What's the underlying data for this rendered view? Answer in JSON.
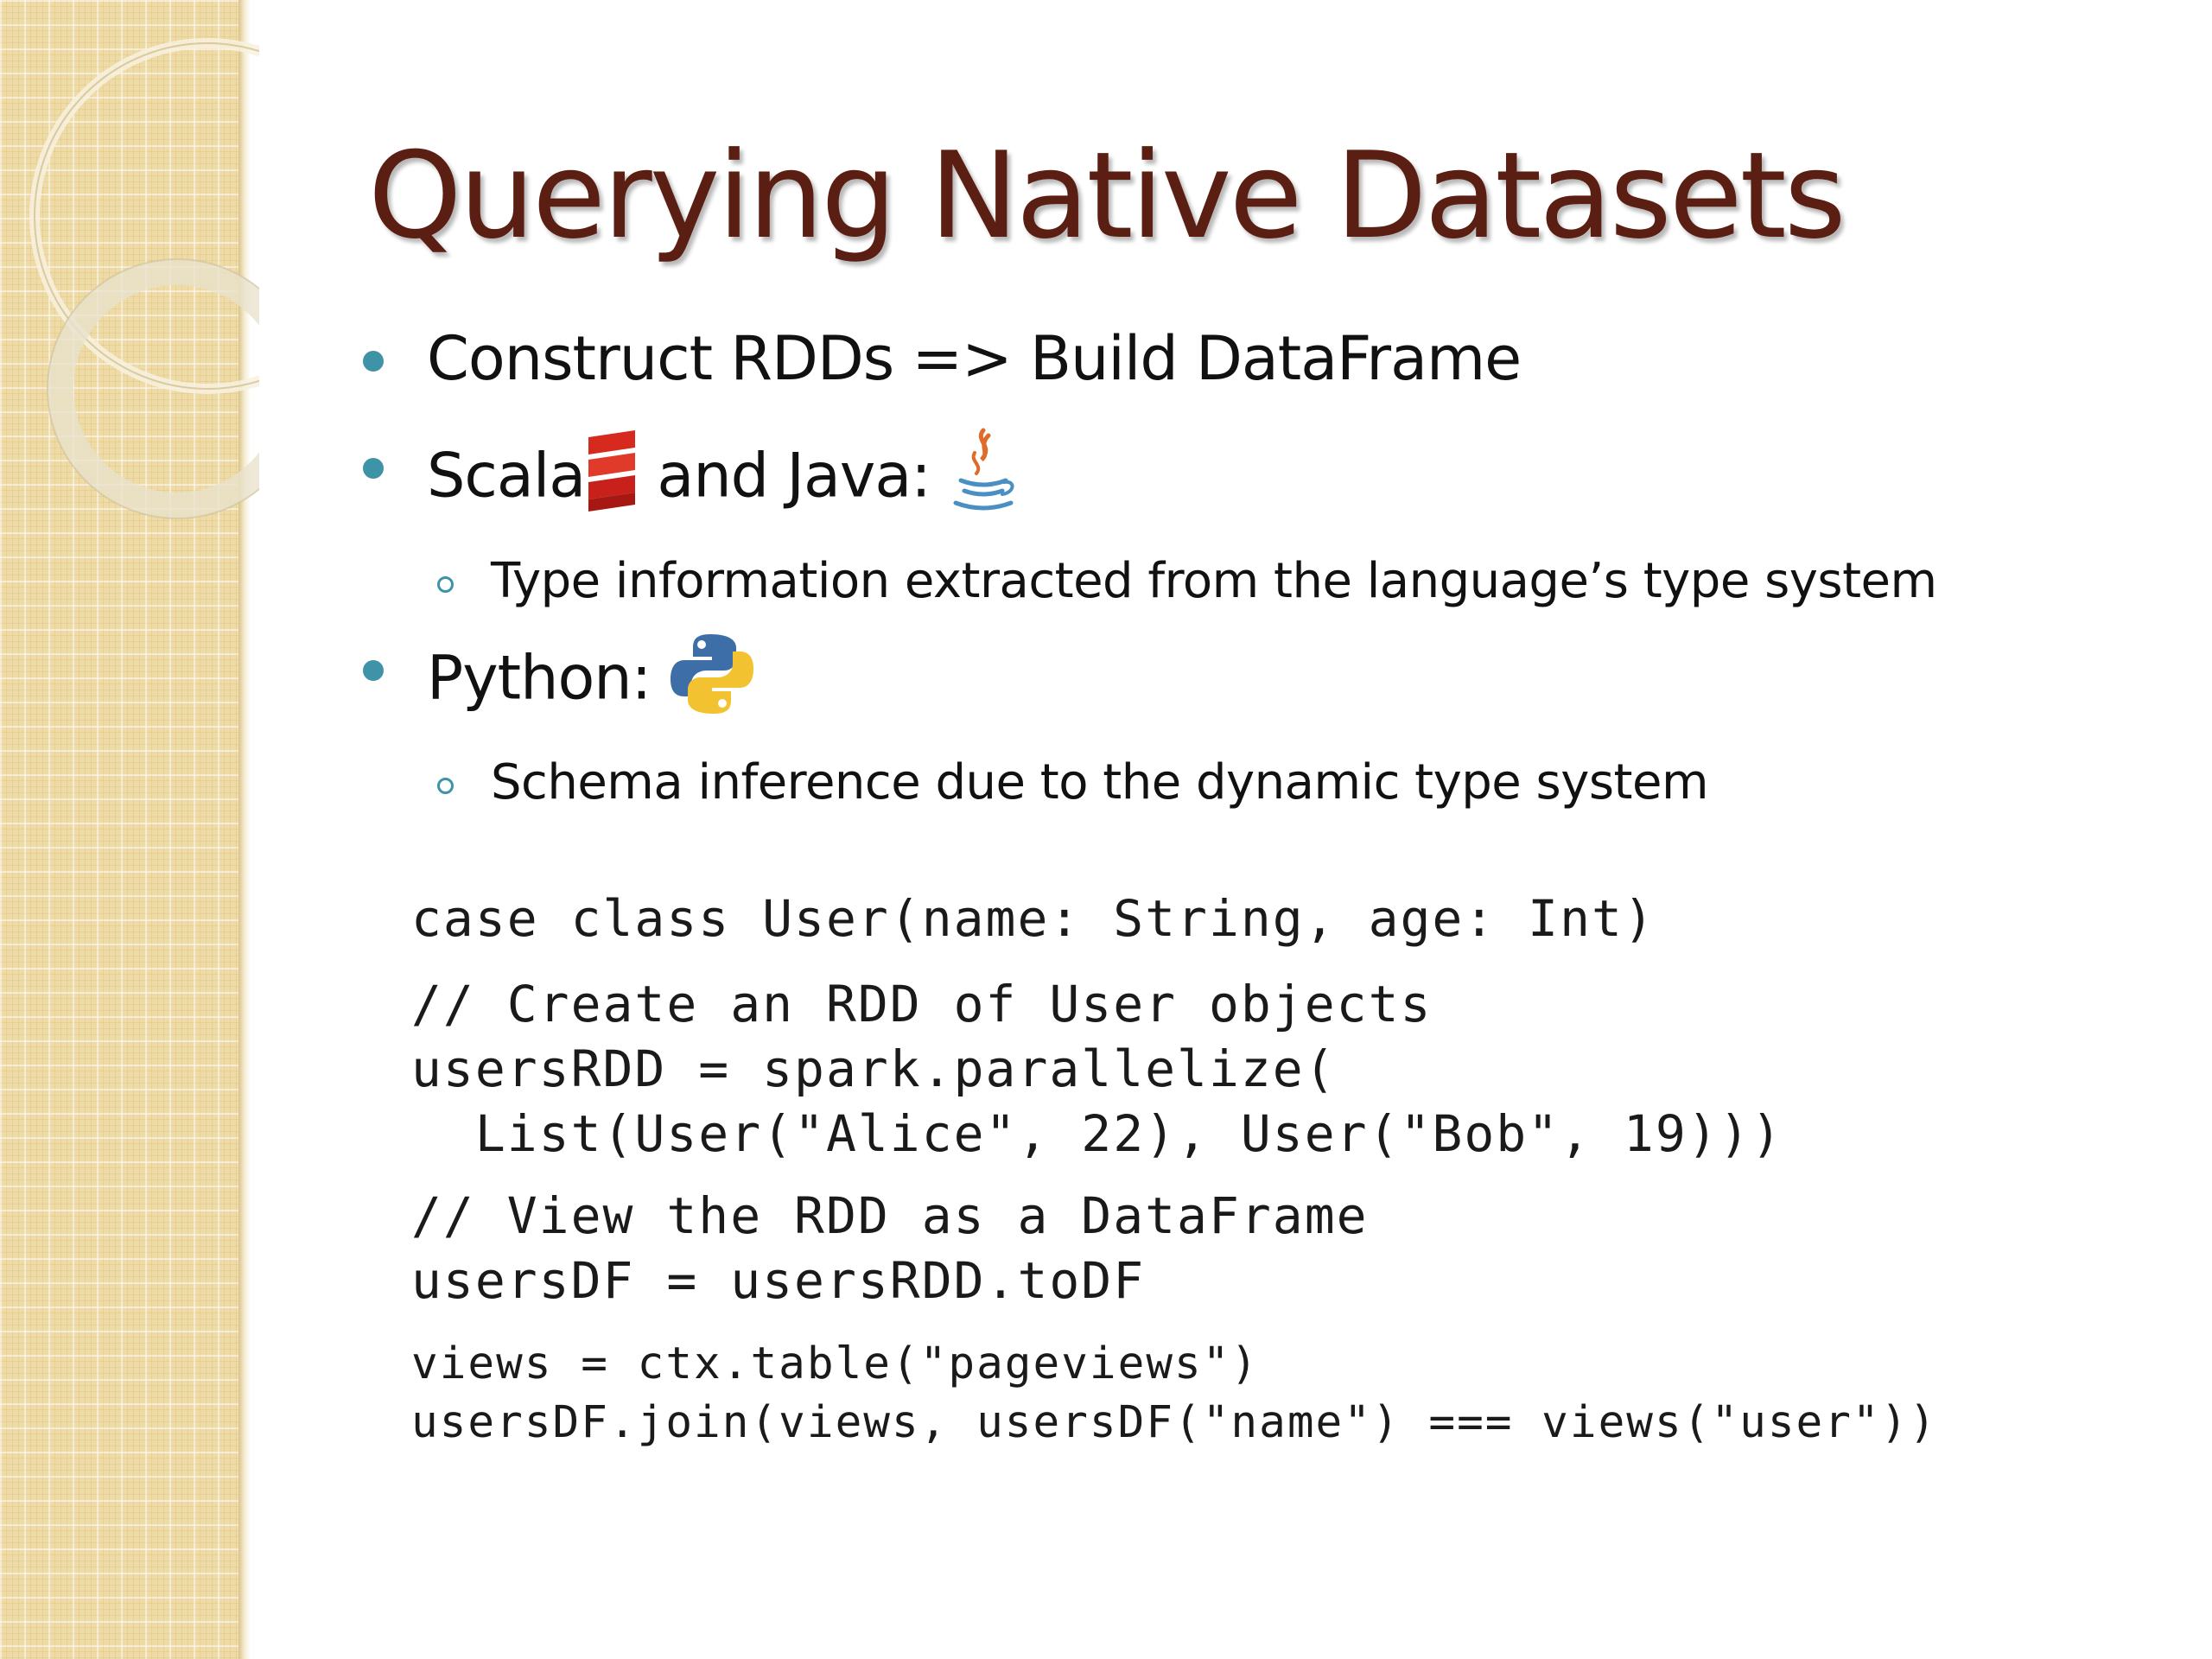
{
  "slide": {
    "title": "Querying Native Datasets",
    "bullets": [
      {
        "text": "Construct RDDs => Build DataFrame"
      },
      {
        "text_before_icon": "Scala",
        "icon": "scala-icon",
        "text_after_icon": " and Java: ",
        "icon2": "java-icon"
      },
      {
        "text": "Type information extracted from the language’s type system"
      },
      {
        "text_before_icon": "Python: ",
        "icon": "python-icon"
      },
      {
        "text": "Schema inference due to the dynamic type system"
      }
    ],
    "code": {
      "line1": "case class User(name: String, age: Int)",
      "line2": "// Create an RDD of User objects",
      "line3": "usersRDD = spark.parallelize(",
      "line4": "  List(User(\"Alice\", 22), User(\"Bob\", 19)))",
      "line5": "// View the RDD as a DataFrame",
      "line6": "usersDF = usersRDD.toDF",
      "line7": "views = ctx.table(\"pageviews\")",
      "line8": "usersDF.join(views, usersDF(\"name\") === views(\"user\"))"
    },
    "colors": {
      "title": "#5a1e12",
      "bullet": "#3f93a7",
      "strip": "#efdba6",
      "text": "#111111"
    }
  }
}
